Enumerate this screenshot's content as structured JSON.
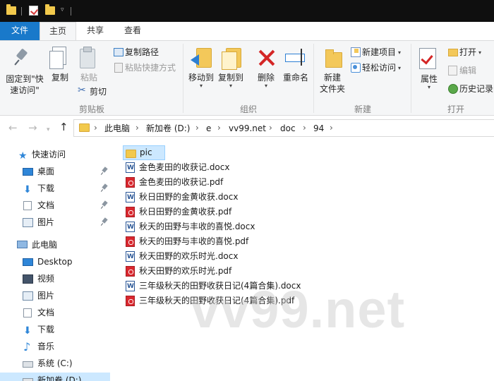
{
  "ribbon_tabs": {
    "file": "文件",
    "home": "主页",
    "share": "共享",
    "view": "查看"
  },
  "clipboard": {
    "pin": "固定到\"快\n速访问\"",
    "pin_line1": "固定到\"快",
    "pin_line2": "速访问\"",
    "copy": "复制",
    "paste": "粘贴",
    "copy_path": "复制路径",
    "paste_shortcut": "粘贴快捷方式",
    "cut": "剪切",
    "group_label": "剪贴板"
  },
  "organize": {
    "move_to": "移动到",
    "copy_to": "复制到",
    "delete": "删除",
    "rename": "重命名",
    "group_label": "组织"
  },
  "new_group": {
    "new_folder_line1": "新建",
    "new_folder_line2": "文件夹",
    "new_item": "新建项目",
    "easy_access": "轻松访问",
    "group_label": "新建"
  },
  "open_group": {
    "properties": "属性",
    "open": "打开",
    "edit": "编辑",
    "history": "历史记录",
    "group_label": "打开"
  },
  "breadcrumb": [
    "此电脑",
    "新加卷 (D:)",
    "e",
    "vv99.net",
    "doc",
    "94"
  ],
  "nav_pane": {
    "quick_access": "快速访问",
    "quick_items": [
      "桌面",
      "下载",
      "文档",
      "图片"
    ],
    "this_pc": "此电脑",
    "pc_items": [
      "Desktop",
      "视频",
      "图片",
      "文档",
      "下载",
      "音乐",
      "系统 (C:)",
      "新加卷 (D:)"
    ]
  },
  "files": [
    {
      "name": "pic",
      "type": "folder"
    },
    {
      "name": "金色麦田的收获记.docx",
      "type": "docx"
    },
    {
      "name": "金色麦田的收获记.pdf",
      "type": "pdf"
    },
    {
      "name": "秋日田野的金黄收获.docx",
      "type": "docx"
    },
    {
      "name": "秋日田野的金黄收获.pdf",
      "type": "pdf"
    },
    {
      "name": "秋天的田野与丰收的喜悦.docx",
      "type": "docx"
    },
    {
      "name": "秋天的田野与丰收的喜悦.pdf",
      "type": "pdf"
    },
    {
      "name": "秋天田野的欢乐时光.docx",
      "type": "docx"
    },
    {
      "name": "秋天田野的欢乐时光.pdf",
      "type": "pdf"
    },
    {
      "name": "三年级秋天的田野收获日记(4篇合集).docx",
      "type": "docx"
    },
    {
      "name": "三年级秋天的田野收获日记(4篇合集).pdf",
      "type": "pdf"
    }
  ],
  "watermark": "vv99.net",
  "colors": {
    "accent": "#1979ca",
    "selection": "#cce8ff",
    "delete_red": "#d42626"
  }
}
